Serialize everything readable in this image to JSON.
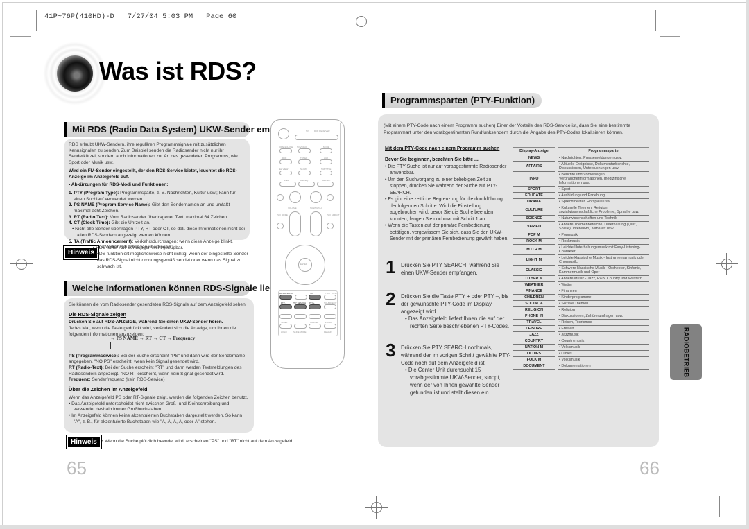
{
  "print_header": "41P~76P(410HD)-D   7/27/04 5:03 PM   Page 60",
  "title": "Was ist RDS?",
  "left": {
    "section1": {
      "heading": "Mit RDS (Radio Data System) UKW-Sender empfangen",
      "intro": "RDS erlaubt UKW-Sendern, ihre regulären Programmsignale mit zusätzlichen Kennsignalen zu senden. Zum Beispiel senden die Radiosender nicht nur ihr Senderkürzel, sondern auch Informationen zur Art des gesendeten Programms, wie Sport oder Musik usw.",
      "bold_note": "Wird ein FM-Sender eingestellt, der den RDS-Service bietet, leuchtet die RDS-Anzeige im Anzeigefeld auf.",
      "abbr_heading": "• Abkürzungen für RDS-Modi und Funktionen:",
      "items": [
        {
          "term": "1. PTY (Program Type):",
          "text": " Programmsparte, z. B. Nachrichten, Kultur usw.; kann für einen Suchlauf verwendet werden."
        },
        {
          "term": "2. PS NAME (Program Service Name):",
          "text": " Gibt den Sendernamen an und umfaßt maximal acht Zeichen."
        },
        {
          "term": "3. RT (Radio Text):",
          "text": " Vom Radiosender übertragener Text; maximal 64 Zeichen."
        },
        {
          "term": "4. CT (Clock Time):",
          "text": " Gibt die Uhrzeit an."
        },
        {
          "term": "",
          "text": "• Nicht alle Sender übertragen PTY, RT oder CT, so daß diese Informationen nicht bei allen RDS-Sendern angezeigt werden können."
        },
        {
          "term": "5. TA (Traffic Announcement):",
          "text": " Verkehrsdurchsagen; wenn diese Anzeige blinkt, werden gerade Verkehrsdurchsagen übertragen."
        }
      ]
    },
    "hint1": {
      "label": "Hinweis",
      "bullets": [
        "• RDS ist für AM-Sendungen nicht  verfügbar.",
        "• RDS funktioniert möglicherweise nicht richtig, wenn der eingestellte Sender das RDS-Signal nicht ordnungsgemäß sendet oder wenn das Signal zu schwach ist."
      ]
    },
    "section2": {
      "heading": "Welche Informationen können RDS-Signale liefern?",
      "intro": "Sie können die vom Radiosender gesendeten RDS-Signale auf dem Anzeigefeld sehen.",
      "sub1_heading": "Die RDS-Signale zeigen",
      "sub1_bold": "Drücken Sie auf RDS-ANZEIGE, während Sie einen UKW-Sender hören.",
      "sub1_text": "Jedes Mal, wenn die Taste gedrückt wird, verändert sich die Anzeige, um Ihnen die folgenden Informationen anzuzeigen:",
      "sequence": "→ PS NAME → RT → CT → Frequency",
      "defs": [
        {
          "term": "PS (Programmservice):",
          "text": " Bei der Suche erscheint \"PS\" und dann wird der Sendername angegeben. \"NO PS\" erscheint, wenn kein Signal gesendet wird."
        },
        {
          "term": "RT (Radio-Text):",
          "text": " Bei der Suche erscheint \"RT\" und dann werden Textmeldungen des Radiosenders angezeigt. \"NO RT erscheint, wenn kein Signal gesendet wird."
        },
        {
          "term": "Frequenz:",
          "text": " Senderfrequenz (kein RDS-Service)"
        }
      ],
      "sub2_heading": "Über die Zeichen im Anzeigefeld",
      "sub2_text": "Wenn das Anzeigefeld PS oder RT-Signale zeigt, werden die folgenden Zeichen benutzt.",
      "sub2_bullets": [
        "• Das Anzeigefeld unterscheidet nicht zwischen Groß- und Kleinschreibung und verwendet deshalb immer Großbuchstaben.",
        "• Im Anzeigefeld können keine akzentuierten Buchstaben dargestellt werden. So kann \"A\", z. B., für akzentuierte Buchstaben wie \"À, Â, Ä, Á, oder Ã\" stehen."
      ]
    },
    "hint2": {
      "label": "Hinweis",
      "text": "• Wenn die Suche plötzlich beendet wird, erscheinen \"PS\" und \"RT\" nicht auf dem Anzeigefeld."
    },
    "page_number": "65"
  },
  "remote": {
    "labels": [
      "TV",
      "DVD RECEIVER",
      "OPEN/CLOSE",
      "TV/VIDEO",
      "MODE",
      "DVD",
      "TUNER",
      "AUX",
      "EZ VIEW",
      "SLOW",
      "SUBTITLE",
      "STEP",
      "DSP/EQ",
      "REPEAT",
      "VOLUME",
      "TUNING/CH",
      "PL II MODE",
      "PL II EFFECT",
      "ENTER",
      "RDS DISPLAY",
      "TA",
      "TEST TONE",
      "PTY-",
      "PTY SEARCH",
      "PTY+",
      "SOUND EDIT",
      "SLEEP",
      "CANCEL",
      "ZOOM",
      "LOGO",
      "SLIDE MODE",
      "REMAIN"
    ]
  },
  "right": {
    "heading": "Programmsparten (PTY-Funktion)",
    "intro": "(Mit einem PTY-Code nach einem Programm suchen) Einer der Vorteile des RDS-Service ist, dass Sie eine bestimmte Programmart unter den vorabgestimmten Rundfunksendern durch die Angabe des PTY-Codes lokalisieren können.",
    "search_heading": "Mit dem PTY-Code nach einem Programm suchen",
    "before_heading": "Bevor Sie beginnen, beachten Sie bitte ...",
    "before_bullets": [
      "• Die PTY-Suche ist nur auf vorabgestimmte Radiosender anwendbar.",
      "• Um den Suchvorgang zu einer beliebigen Zeit zu stoppen, drücken Sie während der Suche auf PTY-SEARCH.",
      "• Es gibt eine zeitliche Begrenzung für die durchführung der folgenden Schritte. Wird die Einstellung abgebrochen wird, bevor Sie die Suche beenden konnten, fangen Sie nochmal mit Schritt 1 an.",
      "• Wenn die Tasten auf der primäre Fernbedienung betätigen, vergewissern Sie sich, dass Sie den UKW-Sender mit der primären Fernbedienung gewählt haben."
    ],
    "steps": [
      {
        "num": "1",
        "text": "Drücken Sie PTY SEARCH, während Sie einen UKW-Sender empfangen.",
        "sub": ""
      },
      {
        "num": "2",
        "text": "Drücken Sie die Taste PTY + oder PTY –, bis der gewünschte PTY-Code im Display angezeigt wird.",
        "sub": "• Das Anzeigefeld liefert Ihnen die auf der rechten Seite beschriebenen PTY-Codes."
      },
      {
        "num": "3",
        "text": "Drücken Sie PTY SEARCH nochmals, während der im vorigen Schritt gewählte PTY-Code noch auf dem Anzeigefeld ist.",
        "sub": "• Die Center Unit durchsucht 15 vorabgestimmte UKW-Sender, stoppt, wenn der von Ihnen gewählte Sender gefunden ist und stellt diesen ein."
      }
    ],
    "table": {
      "headers": [
        "Display-Anzeige",
        "Programmsparte"
      ],
      "rows": [
        [
          "NEWS",
          "• Nachrichten, Pressemeldungen usw."
        ],
        [
          "AFFAIRS",
          "• Aktuelle Ereignisse, Dokumentarberichte, Diskussionen, Untersuchungen usw."
        ],
        [
          "INFO",
          "• Berichte und Vorhersagen, Verbraucherinformationen, medizinische Informationen usw."
        ],
        [
          "SPORT",
          "• Sport"
        ],
        [
          "EDUCATE",
          "• Ausbildung und Erziehung"
        ],
        [
          "DRAMA",
          "• Sprechtheater, Hörspiele usw."
        ],
        [
          "CULTURE",
          "• Kulturelle Themen, Religion, sozialwissenschaftliche Probleme, Sprache usw."
        ],
        [
          "SCIENCE",
          "• Naturwissenschaften und Technik"
        ],
        [
          "VARIED",
          "• Andere Themenbereiche, Unterhaltung (Quiz, Spiele), Interviews, Kabarett usw."
        ],
        [
          "POP M",
          "• Popmusik"
        ],
        [
          "ROCK M",
          "• Rockmusik"
        ],
        [
          "M.O.R.M",
          "• Leichte Unterhaltungsmusik mit Easy-Listening-Charakter."
        ],
        [
          "LIGHT M",
          "• Leichte klassische Musik -  Instrumentalmusik oder Chormusik."
        ],
        [
          "CLASSIC",
          "• Schwere klassische Musik - Orchester, Sinfonie, Kammermusik und Oper"
        ],
        [
          "OTHER M",
          "• Andere Musik - Jazz, R&B, Country und Western"
        ],
        [
          "WEATHER",
          "• Wetter"
        ],
        [
          "FINANCE",
          "• Finanzen"
        ],
        [
          "CHILDREN",
          "• Kinderprogramme"
        ],
        [
          "SOCIAL A",
          "• Soziale Themen"
        ],
        [
          "RELIGION",
          "• Religion"
        ],
        [
          "PHONE IN",
          "• Diskussionen, Zuhörerumfragen usw."
        ],
        [
          "TRAVEL",
          "• Reisen, Tourismus"
        ],
        [
          "LEISURE",
          "• Freizeit"
        ],
        [
          "JAZZ",
          "• Jazzmusik"
        ],
        [
          "COUNTRY",
          "• Countrymusik"
        ],
        [
          "NATION M",
          "• Volksmusik"
        ],
        [
          "OLDIES",
          "• Oldies"
        ],
        [
          "FOLK M",
          "• Volksmusik"
        ],
        [
          "DOCUMENT",
          "• Dokumentationen"
        ]
      ]
    },
    "side_tab": "RADIOBETRIEB",
    "page_number": "66"
  }
}
